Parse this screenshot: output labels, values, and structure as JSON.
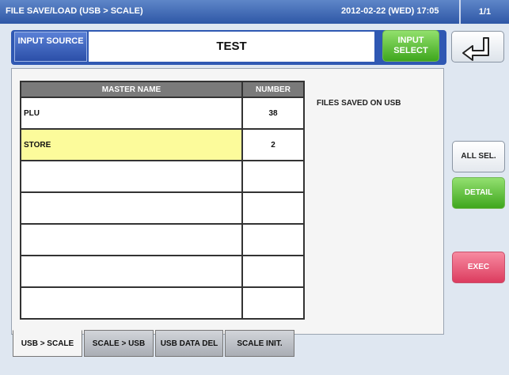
{
  "titlebar": {
    "title": "FILE SAVE/LOAD (USB > SCALE)",
    "datetime": "2012-02-22 (WED)  17:05",
    "page": "1/1"
  },
  "input_source": {
    "label": "INPUT SOURCE",
    "value": "TEST",
    "select_label": "INPUT SELECT"
  },
  "back_icon": "back-arrow-icon",
  "table": {
    "headers": [
      "MASTER NAME",
      "NUMBER"
    ],
    "rows": [
      {
        "name": "PLU",
        "number": "38"
      },
      {
        "name": "STORE",
        "number": "2"
      },
      {
        "name": "",
        "number": ""
      },
      {
        "name": "",
        "number": ""
      },
      {
        "name": "",
        "number": ""
      },
      {
        "name": "",
        "number": ""
      },
      {
        "name": "",
        "number": ""
      }
    ],
    "highlight_row": 1
  },
  "info_text": "FILES SAVED ON USB",
  "buttons": {
    "all_sel": "ALL SEL.",
    "detail": "DETAIL",
    "exec": "EXEC"
  },
  "tabs": [
    {
      "label": "USB > SCALE",
      "active": true
    },
    {
      "label": "SCALE > USB",
      "active": false
    },
    {
      "label": "USB DATA DEL",
      "active": false
    },
    {
      "label": "SCALE INIT.",
      "active": false
    }
  ],
  "colors": {
    "titlebar": "#2e57a6",
    "highlight": "#fcfb9b",
    "select_green": "#3ea61d",
    "exec_red": "#dc3c5f"
  }
}
